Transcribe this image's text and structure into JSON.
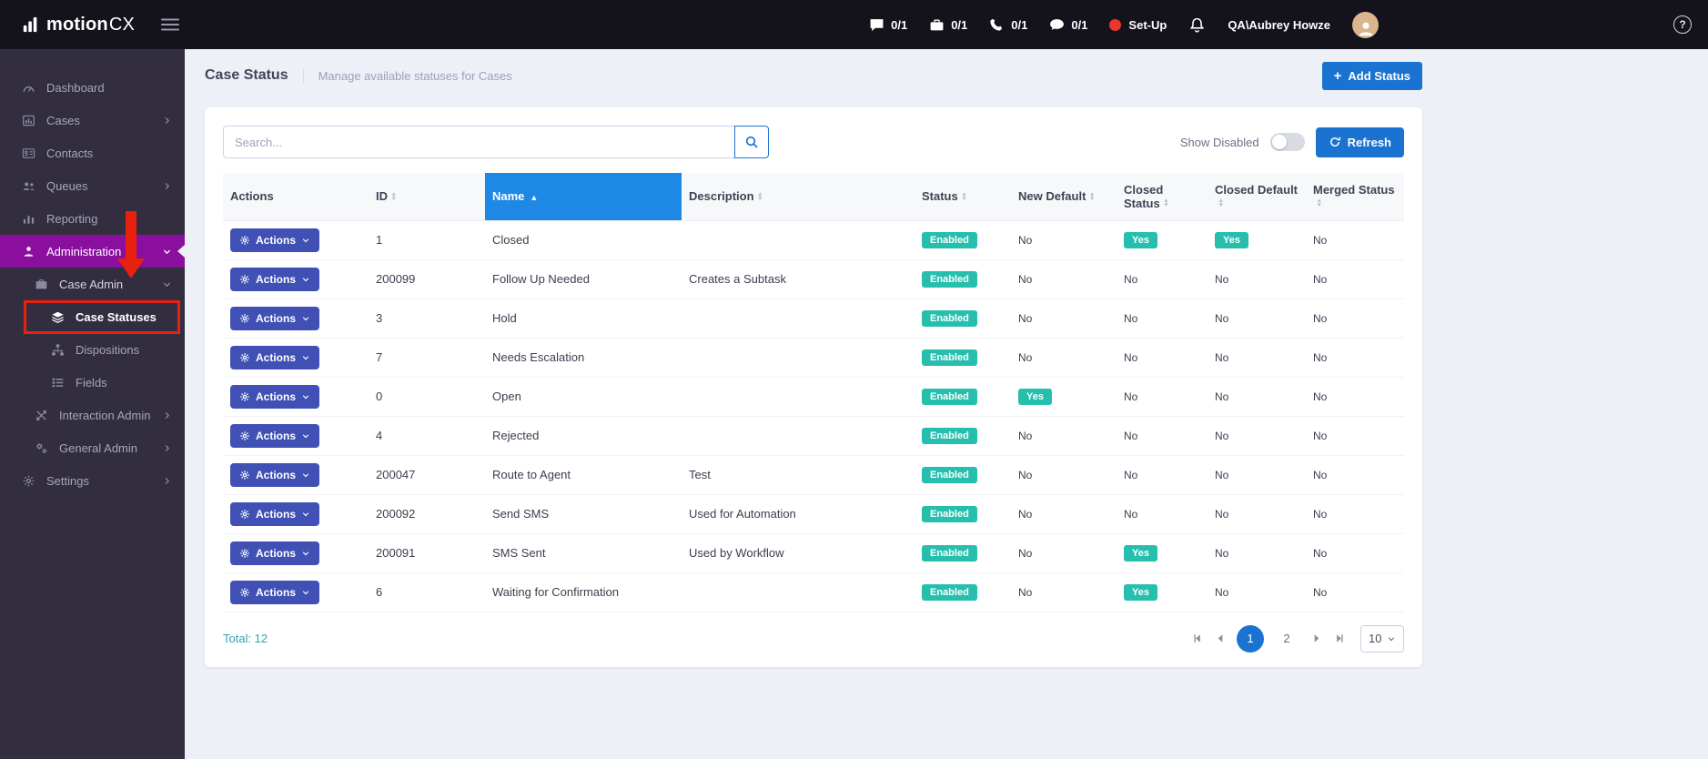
{
  "colors": {
    "topbar_bg": "#14131c",
    "sidebar_bg": "#322e40",
    "main_bg": "#eef0f7",
    "purple": "#8a0f9e",
    "accent_blue": "#1a73d1",
    "header_blue": "#1e88e5",
    "indigo": "#4050b5",
    "teal": "#26bfae",
    "red_annotation": "#e8210f"
  },
  "topbar": {
    "brand_bold": "motion",
    "brand_light": "CX",
    "counters": [
      {
        "icon": "chat-icon",
        "value": "0/1"
      },
      {
        "icon": "briefcase-icon",
        "value": "0/1"
      },
      {
        "icon": "phone-icon",
        "value": "0/1"
      },
      {
        "icon": "comment-icon",
        "value": "0/1"
      }
    ],
    "setup_label": "Set-Up",
    "user_name": "QA\\Aubrey Howze",
    "help_glyph": "?"
  },
  "sidebar": {
    "items": [
      {
        "label": "Dashboard",
        "icon": "dashboard-icon",
        "level": 0
      },
      {
        "label": "Cases",
        "icon": "cases-icon",
        "level": 0,
        "chevron": "right"
      },
      {
        "label": "Contacts",
        "icon": "contacts-icon",
        "level": 0
      },
      {
        "label": "Queues",
        "icon": "queues-icon",
        "level": 0,
        "chevron": "right"
      },
      {
        "label": "Reporting",
        "icon": "reporting-icon",
        "level": 0
      },
      {
        "label": "Administration",
        "icon": "administration-icon",
        "level": 0,
        "chevron": "down",
        "active": true
      },
      {
        "label": "Case Admin",
        "icon": "case-admin-icon",
        "level": 1,
        "chevron": "down",
        "expanded": true
      },
      {
        "label": "Case Statuses",
        "icon": "case-statuses-icon",
        "level": 2,
        "selected": true
      },
      {
        "label": "Dispositions",
        "icon": "dispositions-icon",
        "level": 2
      },
      {
        "label": "Fields",
        "icon": "fields-icon",
        "level": 2
      },
      {
        "label": "Interaction Admin",
        "icon": "interaction-admin-icon",
        "level": 1,
        "chevron": "right"
      },
      {
        "label": "General Admin",
        "icon": "general-admin-icon",
        "level": 1,
        "chevron": "right"
      },
      {
        "label": "Settings",
        "icon": "settings-icon",
        "level": 0,
        "chevron": "right"
      }
    ]
  },
  "annotations": {
    "type": "red-arrow-and-box",
    "target": "Case Statuses"
  },
  "page": {
    "title": "Case Status",
    "subtitle": "Manage available statuses for Cases",
    "add_button_plus": "+",
    "add_button_label": "Add Status"
  },
  "toolbar": {
    "search_placeholder": "Search...",
    "search_value": "",
    "show_disabled_label": "Show Disabled",
    "show_disabled_on": false,
    "refresh_label": "Refresh"
  },
  "table": {
    "columns": [
      {
        "label": "Actions",
        "sortable": false
      },
      {
        "label": "ID",
        "sortable": true
      },
      {
        "label": "Name",
        "sortable": true,
        "active": true,
        "sorted": "asc"
      },
      {
        "label": "Description",
        "sortable": true
      },
      {
        "label": "Status",
        "sortable": true
      },
      {
        "label": "New Default",
        "sortable": true
      },
      {
        "label": "Closed Status",
        "sortable": true
      },
      {
        "label": "Closed Default",
        "sortable": true
      },
      {
        "label": "Merged Status",
        "sortable": true
      }
    ],
    "action_button_label": "Actions",
    "rows": [
      {
        "id": "1",
        "name": "Closed",
        "description": "",
        "status": "Enabled",
        "new_default": "No",
        "closed_status": "Yes",
        "closed_default": "Yes",
        "merged_status": "No"
      },
      {
        "id": "200099",
        "name": "Follow Up Needed",
        "description": "Creates a Subtask",
        "status": "Enabled",
        "new_default": "No",
        "closed_status": "No",
        "closed_default": "No",
        "merged_status": "No"
      },
      {
        "id": "3",
        "name": "Hold",
        "description": "",
        "status": "Enabled",
        "new_default": "No",
        "closed_status": "No",
        "closed_default": "No",
        "merged_status": "No"
      },
      {
        "id": "7",
        "name": "Needs Escalation",
        "description": "",
        "status": "Enabled",
        "new_default": "No",
        "closed_status": "No",
        "closed_default": "No",
        "merged_status": "No"
      },
      {
        "id": "0",
        "name": "Open",
        "description": "",
        "status": "Enabled",
        "new_default": "Yes",
        "closed_status": "No",
        "closed_default": "No",
        "merged_status": "No"
      },
      {
        "id": "4",
        "name": "Rejected",
        "description": "",
        "status": "Enabled",
        "new_default": "No",
        "closed_status": "No",
        "closed_default": "No",
        "merged_status": "No"
      },
      {
        "id": "200047",
        "name": "Route to Agent",
        "description": "Test",
        "status": "Enabled",
        "new_default": "No",
        "closed_status": "No",
        "closed_default": "No",
        "merged_status": "No"
      },
      {
        "id": "200092",
        "name": "Send SMS",
        "description": "Used for Automation",
        "status": "Enabled",
        "new_default": "No",
        "closed_status": "No",
        "closed_default": "No",
        "merged_status": "No"
      },
      {
        "id": "200091",
        "name": "SMS Sent",
        "description": "Used by Workflow",
        "status": "Enabled",
        "new_default": "No",
        "closed_status": "Yes",
        "closed_default": "No",
        "merged_status": "No"
      },
      {
        "id": "6",
        "name": "Waiting for Confirmation",
        "description": "",
        "status": "Enabled",
        "new_default": "No",
        "closed_status": "Yes",
        "closed_default": "No",
        "merged_status": "No"
      }
    ]
  },
  "footer": {
    "total_label": "Total: 12",
    "pages": [
      "1",
      "2"
    ],
    "active_page": "1",
    "page_size": "10"
  }
}
